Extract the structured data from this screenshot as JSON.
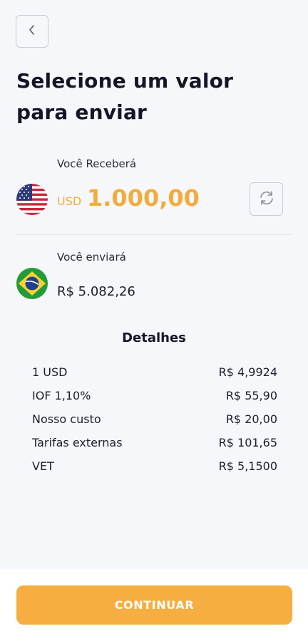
{
  "header": {
    "back_icon": "chevron-left-icon",
    "title": "Selecione um valor para enviar"
  },
  "receive": {
    "label": "Você Receberá",
    "currency": "USD",
    "amount": "1.000,00",
    "flag": "us-flag-icon",
    "swap_icon": "refresh-icon"
  },
  "send": {
    "label": "Você enviará",
    "amount": "R$ 5.082,26",
    "flag": "brazil-flag-icon"
  },
  "details": {
    "title": "Detalhes",
    "rows": [
      {
        "label": "1 USD",
        "value": "R$ 4,9924"
      },
      {
        "label": "IOF 1,10%",
        "value": "R$ 55,90"
      },
      {
        "label": "Nosso custo",
        "value": "R$ 20,00"
      },
      {
        "label": "Tarifas externas",
        "value": "R$ 101,65"
      },
      {
        "label": "VET",
        "value": "R$ 5,1500"
      }
    ]
  },
  "footer": {
    "continue_label": "CONTINUAR"
  },
  "colors": {
    "accent": "#f5ae3f",
    "background": "#f6f7fb"
  }
}
